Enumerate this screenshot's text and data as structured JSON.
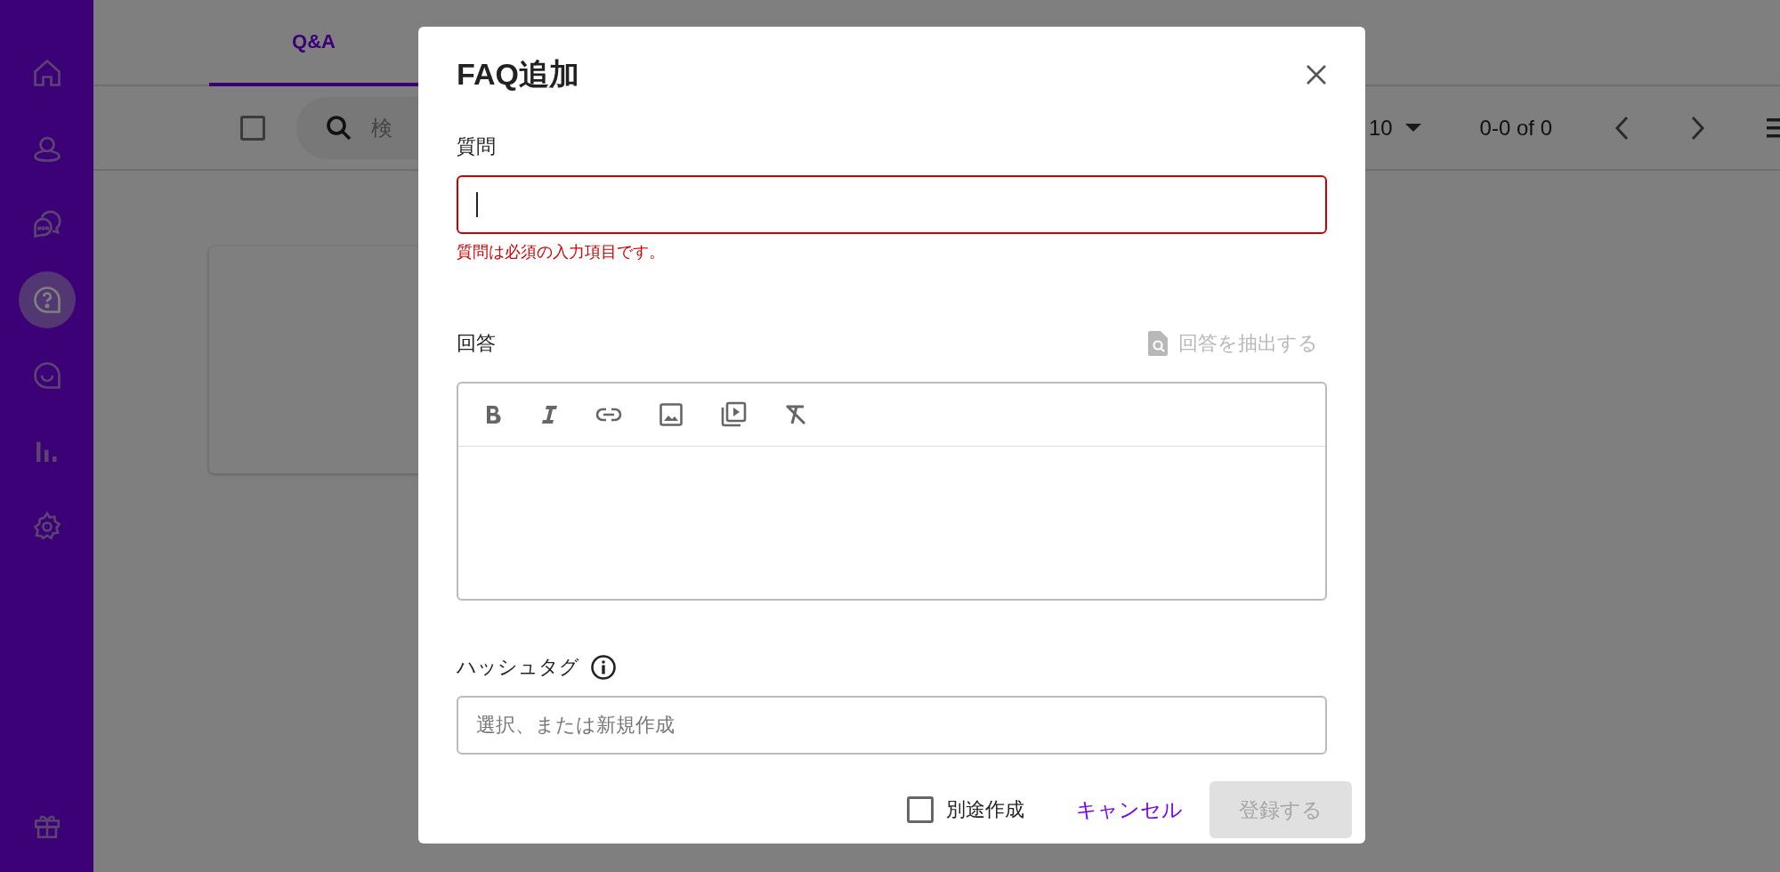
{
  "sidebar": {
    "items": [
      {
        "kind": "home",
        "selected": false
      },
      {
        "kind": "user",
        "selected": false
      },
      {
        "kind": "chat",
        "selected": false
      },
      {
        "kind": "faq",
        "selected": true
      },
      {
        "kind": "smile",
        "selected": false
      },
      {
        "kind": "stats",
        "selected": false
      },
      {
        "kind": "settings",
        "selected": false
      }
    ],
    "bottom_items": [
      {
        "kind": "gift",
        "selected": false
      }
    ]
  },
  "tabs": [
    {
      "label": "Q&A",
      "selected": true
    }
  ],
  "toolbar": {
    "select_all_checked": false,
    "search": {
      "placeholder": "検"
    },
    "rows_per_page": "10",
    "range": "0-0 of 0"
  },
  "dialog": {
    "title": "FAQ追加",
    "question": {
      "label": "質問",
      "error": "質問は必須の入力項目です。"
    },
    "answer": {
      "label": "回答",
      "extract_button": {
        "label": "回答を抽出する",
        "disabled": true
      },
      "tools": [
        {
          "kind": "bold"
        },
        {
          "kind": "italic"
        },
        {
          "kind": "link"
        },
        {
          "kind": "image"
        },
        {
          "kind": "video"
        },
        {
          "kind": "clear"
        }
      ]
    },
    "hashtags": {
      "label": "ハッシュタグ",
      "placeholder": "選択、または新規作成"
    },
    "create_separately": {
      "label": "別途作成",
      "checked": false
    },
    "cancel": "キャンセル",
    "submit": {
      "label": "登録する",
      "disabled": true
    }
  }
}
